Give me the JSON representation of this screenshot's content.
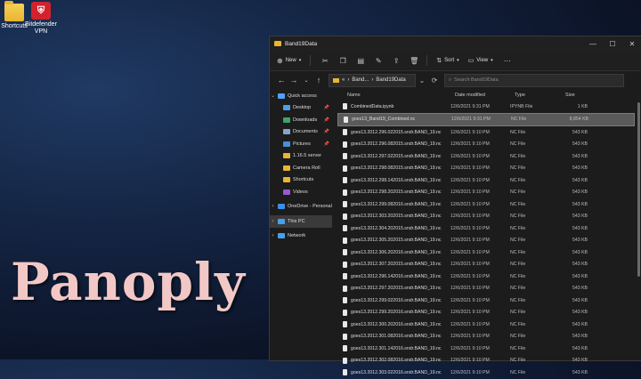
{
  "desktop": {
    "icons": [
      {
        "label": "Shortcuts",
        "icon": "folder-icon"
      },
      {
        "label": "Bitdefender VPN",
        "icon": "bitdefender-vpn-icon"
      }
    ],
    "overlay_text": "Panoply"
  },
  "window": {
    "title": "Band19Data",
    "controls": {
      "minimize": "—",
      "maximize": "☐",
      "close": "✕"
    },
    "toolbar": {
      "new_label": "New",
      "sort_label": "Sort",
      "view_label": "View"
    },
    "address": {
      "path_left": "«",
      "path_segment": "Band...",
      "path_current": "Band19Data"
    },
    "search_placeholder": "Search Band19Data",
    "sidebar": [
      {
        "label": "Quick access",
        "icon": "star-icon",
        "color": "#4da3ff",
        "expand": "⌄",
        "pinned": false,
        "selected": false
      },
      {
        "label": "Desktop",
        "icon": "desktop-icon",
        "color": "#4aa0e8",
        "expand": "",
        "pinned": true,
        "selected": false
      },
      {
        "label": "Downloads",
        "icon": "download-icon",
        "color": "#3fa36a",
        "expand": "",
        "pinned": true,
        "selected": false
      },
      {
        "label": "Documents",
        "icon": "documents-icon",
        "color": "#8aa4c8",
        "expand": "",
        "pinned": true,
        "selected": false
      },
      {
        "label": "Pictures",
        "icon": "pictures-icon",
        "color": "#4a8ed8",
        "expand": "",
        "pinned": true,
        "selected": false
      },
      {
        "label": "1.16.5 server",
        "icon": "folder-icon",
        "color": "#e9b533",
        "expand": "",
        "pinned": false,
        "selected": false
      },
      {
        "label": "Camera Roll",
        "icon": "folder-icon",
        "color": "#e9b533",
        "expand": "",
        "pinned": false,
        "selected": false
      },
      {
        "label": "Shortcuts",
        "icon": "folder-icon",
        "color": "#e9b533",
        "expand": "",
        "pinned": false,
        "selected": false
      },
      {
        "label": "Videos",
        "icon": "videos-icon",
        "color": "#9b59d0",
        "expand": "",
        "pinned": false,
        "selected": false
      },
      {
        "label": "OneDrive - Personal",
        "icon": "cloud-icon",
        "color": "#3a8ee6",
        "expand": "›",
        "pinned": false,
        "selected": false
      },
      {
        "label": "This PC",
        "icon": "pc-icon",
        "color": "#4aa0e8",
        "expand": "›",
        "pinned": false,
        "selected": true
      },
      {
        "label": "Network",
        "icon": "network-icon",
        "color": "#4aa0e8",
        "expand": "›",
        "pinned": false,
        "selected": false
      }
    ],
    "columns": {
      "name": "Name",
      "date": "Date modified",
      "type": "Type",
      "size": "Size"
    },
    "files": [
      {
        "name": "CombinedData.ipynb",
        "date": "12/6/2021 9:31 PM",
        "type": "IPYNB File",
        "size": "1 KB",
        "selected": false
      },
      {
        "name": "goes13_Band19_Combined.nc",
        "date": "12/6/2021 9:31 PM",
        "type": "NC File",
        "size": "8,854 KB",
        "selected": true
      },
      {
        "name": "goes13.2012.296.022015.sndr.BAND_19.nc",
        "date": "12/6/2021 9:10 PM",
        "type": "NC File",
        "size": "543 KB",
        "selected": false
      },
      {
        "name": "goes13.2012.296.082015.sndr.BAND_19.nc",
        "date": "12/6/2021 9:10 PM",
        "type": "NC File",
        "size": "543 KB",
        "selected": false
      },
      {
        "name": "goes13.2012.297.022015.sndr.BAND_19.nc",
        "date": "12/6/2021 9:10 PM",
        "type": "NC File",
        "size": "543 KB",
        "selected": false
      },
      {
        "name": "goes13.2012.298.082015.sndr.BAND_19.nc",
        "date": "12/6/2021 9:10 PM",
        "type": "NC File",
        "size": "543 KB",
        "selected": false
      },
      {
        "name": "goes13.2012.298.142016.sndr.BAND_19.nc",
        "date": "12/6/2021 9:10 PM",
        "type": "NC File",
        "size": "543 KB",
        "selected": false
      },
      {
        "name": "goes13.2012.298.202015.sndr.BAND_19.nc",
        "date": "12/6/2021 9:10 PM",
        "type": "NC File",
        "size": "543 KB",
        "selected": false
      },
      {
        "name": "goes13.2012.299.082016.sndr.BAND_19.nc",
        "date": "12/6/2021 9:10 PM",
        "type": "NC File",
        "size": "543 KB",
        "selected": false
      },
      {
        "name": "goes13.2012.303.202015.sndr.BAND_19.nc",
        "date": "12/6/2021 9:10 PM",
        "type": "NC File",
        "size": "543 KB",
        "selected": false
      },
      {
        "name": "goes13.2012.304.202015.sndr.BAND_19.nc",
        "date": "12/6/2021 9:10 PM",
        "type": "NC File",
        "size": "543 KB",
        "selected": false
      },
      {
        "name": "goes13.2012.305.202015.sndr.BAND_19.nc",
        "date": "12/6/2021 9:10 PM",
        "type": "NC File",
        "size": "543 KB",
        "selected": false
      },
      {
        "name": "goes13.2012.306.202016.sndr.BAND_19.nc",
        "date": "12/6/2021 9:10 PM",
        "type": "NC File",
        "size": "543 KB",
        "selected": false
      },
      {
        "name": "goes13.2012.307.202015.sndr.BAND_19.nc",
        "date": "12/6/2021 9:10 PM",
        "type": "NC File",
        "size": "543 KB",
        "selected": false
      },
      {
        "name": "goes13.2012.296.142016.sndr.BAND_19.nc",
        "date": "12/6/2021 9:10 PM",
        "type": "NC File",
        "size": "543 KB",
        "selected": false
      },
      {
        "name": "goes13.2012.297.202015.sndr.BAND_19.nc",
        "date": "12/6/2021 9:10 PM",
        "type": "NC File",
        "size": "543 KB",
        "selected": false
      },
      {
        "name": "goes13.2012.299.022016.sndr.BAND_19.nc",
        "date": "12/6/2021 9:10 PM",
        "type": "NC File",
        "size": "543 KB",
        "selected": false
      },
      {
        "name": "goes13.2012.299.202016.sndr.BAND_19.nc",
        "date": "12/6/2021 9:10 PM",
        "type": "NC File",
        "size": "543 KB",
        "selected": false
      },
      {
        "name": "goes13.2012.300.202016.sndr.BAND_19.nc",
        "date": "12/6/2021 9:10 PM",
        "type": "NC File",
        "size": "543 KB",
        "selected": false
      },
      {
        "name": "goes13.2012.301.082016.sndr.BAND_19.nc",
        "date": "12/6/2021 9:10 PM",
        "type": "NC File",
        "size": "543 KB",
        "selected": false
      },
      {
        "name": "goes13.2012.301.142016.sndr.BAND_19.nc",
        "date": "12/6/2021 9:10 PM",
        "type": "NC File",
        "size": "543 KB",
        "selected": false
      },
      {
        "name": "goes13.2012.302.082016.sndr.BAND_19.nc",
        "date": "12/6/2021 9:10 PM",
        "type": "NC File",
        "size": "543 KB",
        "selected": false
      },
      {
        "name": "goes13.2012.303.022016.sndr.BAND_19.nc",
        "date": "12/6/2021 9:10 PM",
        "type": "NC File",
        "size": "543 KB",
        "selected": false
      }
    ]
  }
}
